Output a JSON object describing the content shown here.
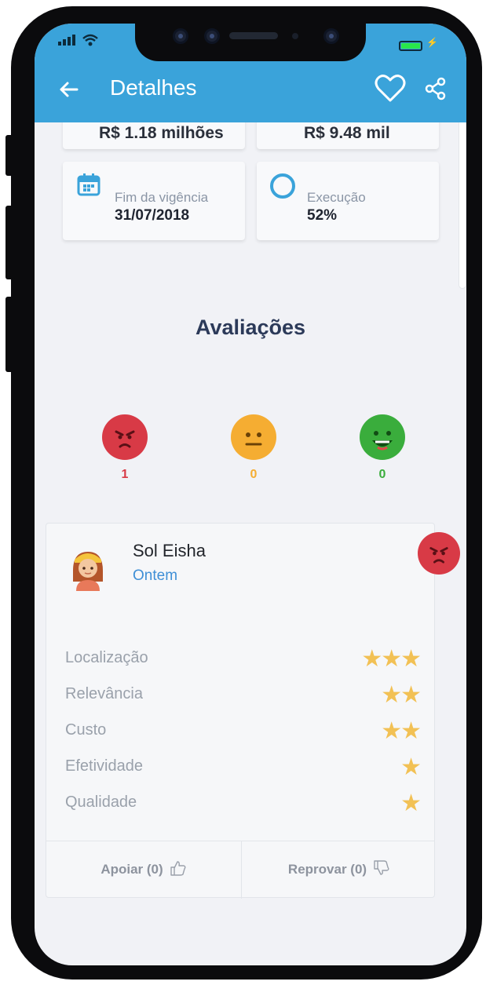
{
  "header": {
    "title": "Detalhes"
  },
  "info_cards": {
    "top_left_partial": "R$ 1.18 milhões",
    "top_right_partial": "R$ 9.48 mil",
    "end_of_term": {
      "label": "Fim da vigência",
      "value": "31/07/2018"
    },
    "execution": {
      "label": "Execução",
      "value": "52%"
    }
  },
  "ratings": {
    "title": "Avaliações",
    "summary": [
      {
        "mood": "angry",
        "count": "1",
        "color": "#d83a46"
      },
      {
        "mood": "neutral",
        "count": "0",
        "color": "#f5ad32"
      },
      {
        "mood": "happy",
        "count": "0",
        "color": "#3aad3c"
      }
    ]
  },
  "review": {
    "name": "Sol Eisha",
    "date": "Ontem",
    "mood": "angry",
    "criteria": [
      {
        "label": "Localização",
        "stars": 3
      },
      {
        "label": "Relevância",
        "stars": 2
      },
      {
        "label": "Custo",
        "stars": 2
      },
      {
        "label": "Efetividade",
        "stars": 1
      },
      {
        "label": "Qualidade",
        "stars": 1
      }
    ],
    "support_label": "Apoiar (0)",
    "reject_label": "Reprovar (0)"
  },
  "colors": {
    "app_bar": "#3aa3da",
    "accent_blue": "#3f8fd6",
    "star": "#f2c155"
  },
  "icons": [
    "signal-icon",
    "wifi-icon",
    "battery-icon",
    "back-arrow-icon",
    "heart-icon",
    "share-icon",
    "calendar-icon",
    "progress-ring-icon",
    "angry-face-icon",
    "neutral-face-icon",
    "happy-face-icon",
    "avatar",
    "thumbs-up-icon",
    "thumbs-down-icon"
  ]
}
